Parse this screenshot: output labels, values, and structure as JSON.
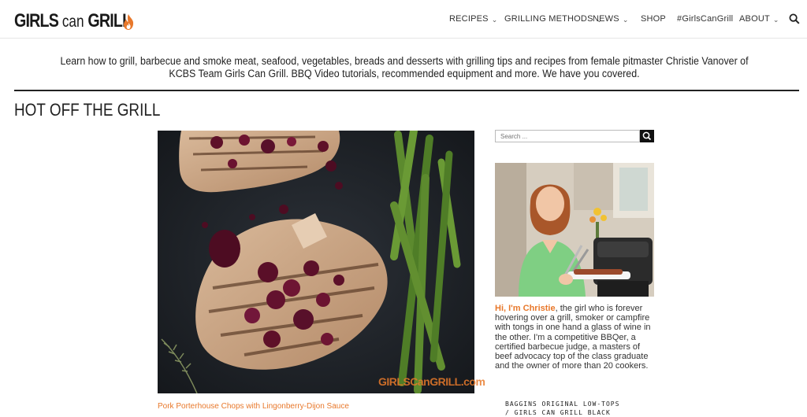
{
  "brand": {
    "logo_main": "GIRLS",
    "logo_mid": " can ",
    "logo_end": "GRILL",
    "accent": "#e8782b"
  },
  "nav": {
    "items": [
      {
        "label": "RECIPES",
        "dropdown": true
      },
      {
        "label": "GRILLING METHODS",
        "dropdown": true
      },
      {
        "label": "NEWS",
        "dropdown": true
      },
      {
        "label": "SHOP",
        "dropdown": false
      },
      {
        "label": "#GirlsCanGrill",
        "dropdown": false
      },
      {
        "label": "ABOUT",
        "dropdown": true
      }
    ],
    "search_icon": "search-icon"
  },
  "intro": "Learn how to grill, barbecue and smoke meat, seafood, vegetables, breads and desserts with grilling tips and recipes from female pitmaster Christie Vanover of KCBS Team Girls Can Grill. BBQ Video tutorials, recommended equipment and more. We have you covered.",
  "section_title": "HOT OFF THE GRILL",
  "hero": {
    "watermark": "GIRLSCanGRILL.com",
    "caption": "Pork Porterhouse Chops with Lingonberry-Dijon Sauce"
  },
  "sidebar": {
    "search_placeholder": "Search ...",
    "bio_hi": "Hi, I'm Christie",
    "bio_text": ", the girl who is forever hovering over a grill, smoker or campfire with tongs in one hand a glass of wine in the other. I'm a competitive BBQer, a certified barbecue judge, a masters of beef advocacy top of the class graduate and the owner of more than 20 cookers.",
    "promo_line1": "BAGGINS ORIGINAL LOW-TOPS",
    "promo_line2": "/ GIRLS CAN GRILL BLACK"
  }
}
